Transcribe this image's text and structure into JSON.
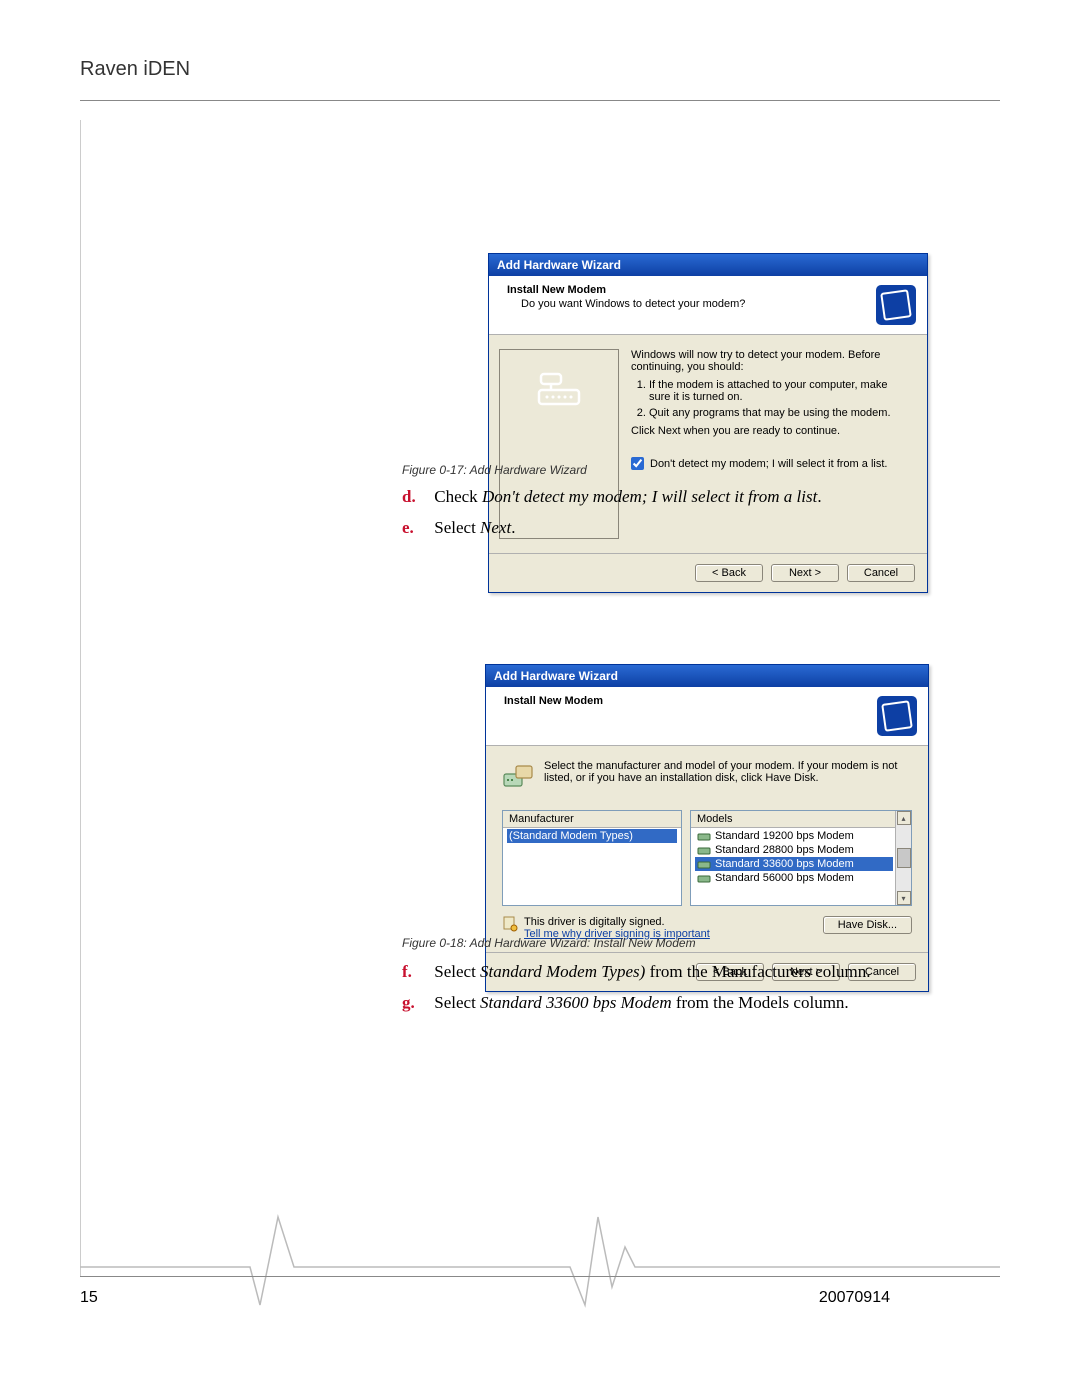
{
  "doc": {
    "header": "Raven iDEN",
    "page_number": "15",
    "date": "20070914"
  },
  "captions": {
    "fig1": "Figure 0-17: Add Hardware Wizard",
    "fig2": "Figure 0-18: Add Hardware Wizard: Install New Modem"
  },
  "steps": {
    "d_letter": "d.",
    "d_lead": "Check ",
    "d_italic": "Don't detect my modem; I will select it from a list",
    "d_tail": ".",
    "e_letter": "e.",
    "e_lead": "Select ",
    "e_italic": "Next",
    "e_tail": ".",
    "f_letter": "f.",
    "f_lead": "Select ",
    "f_italic": "Standard Modem Types)",
    "f_tail": " from the Manufacturers column.",
    "g_letter": "g.",
    "g_lead": "Select ",
    "g_italic": "Standard 33600 bps Modem",
    "g_tail": " from the Models column."
  },
  "wizard_common": {
    "title": "Add Hardware Wizard",
    "header_title": "Install New Modem",
    "back": "< Back",
    "next": "Next >",
    "cancel": "Cancel"
  },
  "wiz1": {
    "header_sub": "Do you want Windows to detect your modem?",
    "intro": "Windows will now try to detect your modem.  Before continuing, you should:",
    "li1": "If the modem is attached to your computer, make sure it is turned on.",
    "li2": "Quit any programs that may be using the modem.",
    "click_next": "Click Next when you are ready to continue.",
    "checkbox_label": "Don't detect my modem; I will select it from a list."
  },
  "wiz2": {
    "instructions": "Select the manufacturer and model of your modem. If your modem is not listed, or if you have an installation disk, click Have Disk.",
    "manufacturer_header": "Manufacturer",
    "manufacturer_item": "(Standard Modem Types)",
    "models_header": "Models",
    "model1": "Standard 19200 bps Modem",
    "model2": "Standard 28800 bps Modem",
    "model3": "Standard 33600 bps Modem",
    "model4": "Standard 56000 bps Modem",
    "signed": "This driver is digitally signed.",
    "why_link": "Tell me why driver signing is important",
    "have_disk": "Have Disk..."
  }
}
